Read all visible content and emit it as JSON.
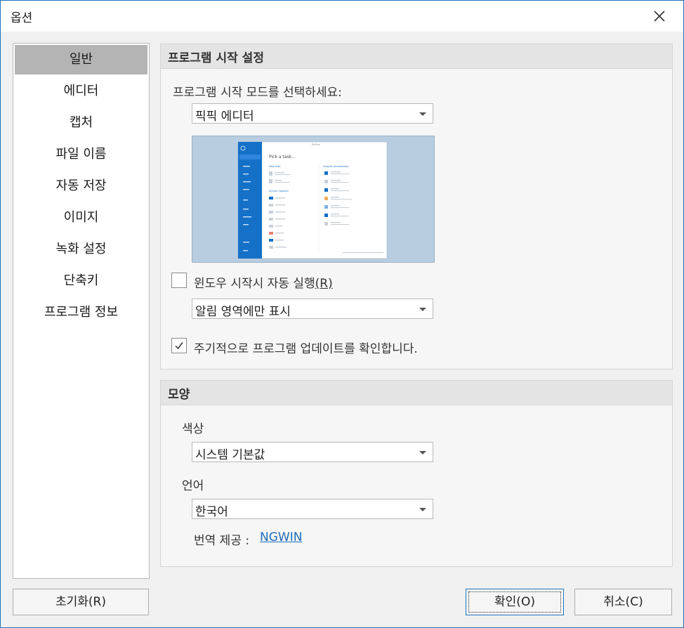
{
  "window": {
    "title": "옵션"
  },
  "sidebar": {
    "selected_index": 0,
    "items": [
      {
        "label": "일반"
      },
      {
        "label": "에디터"
      },
      {
        "label": "캡처"
      },
      {
        "label": "파일 이름"
      },
      {
        "label": "자동 저장"
      },
      {
        "label": "이미지"
      },
      {
        "label": "녹화 설정"
      },
      {
        "label": "단축키"
      },
      {
        "label": "프로그램 정보"
      }
    ]
  },
  "startup": {
    "header": "프로그램 시작 설정",
    "mode_label": "프로그램 시작 모드를 선택하세요:",
    "mode_value": "픽픽 에디터",
    "preview": {
      "app_title": "PicPick",
      "heading": "Pick a task...",
      "section_left": "New task",
      "section_right": "Graphic Accessories",
      "section_left_2": "Screen Capture"
    },
    "autorun_label": "윈도우 시작시 자동 실행",
    "autorun_mnemonic": "(R)",
    "autorun_checked": false,
    "tray_value": "알림 영역에만 표시",
    "update_label": "주기적으로 프로그램 업데이트를 확인합니다.",
    "update_checked": true
  },
  "appearance": {
    "header": "모양",
    "color_label": "색상",
    "color_value": "시스템 기본값",
    "language_label": "언어",
    "language_value": "한국어",
    "translator_label": "번역 제공 : ",
    "translator_link": "NGWIN"
  },
  "buttons": {
    "reset": "초기화(R)",
    "ok": "확인(O)",
    "cancel": "취소(C)"
  },
  "colors": {
    "accent": "#1e73be",
    "link": "#1e6bb8",
    "selected": "#b4b4b4"
  }
}
